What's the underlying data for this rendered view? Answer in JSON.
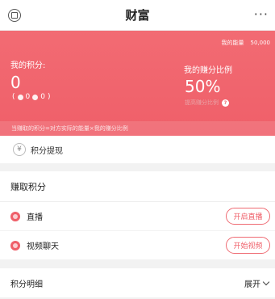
{
  "nav": {
    "title": "财富",
    "more": "···"
  },
  "banner": {
    "energy_label": "我的能量",
    "energy_value": "50,000",
    "my_points_label": "我的积分:",
    "my_points_value": "0",
    "sub_a": "0",
    "sub_b": "0",
    "ratio_label": "我的赚分比例",
    "ratio_value": "50%",
    "raise_link": "提高赚分比例",
    "formula": "当赚取的积分=对方实际的能量×我的赚分比例",
    "accent": "#ef5f69"
  },
  "withdraw": {
    "icon": "yen-icon",
    "label": "积分提现"
  },
  "earn": {
    "title": "赚取积分",
    "items": [
      {
        "label": "直播",
        "button": "开启直播"
      },
      {
        "label": "视频聊天",
        "button": "开始视频"
      }
    ]
  },
  "detail": {
    "title": "积分明细",
    "expand": "展开"
  }
}
